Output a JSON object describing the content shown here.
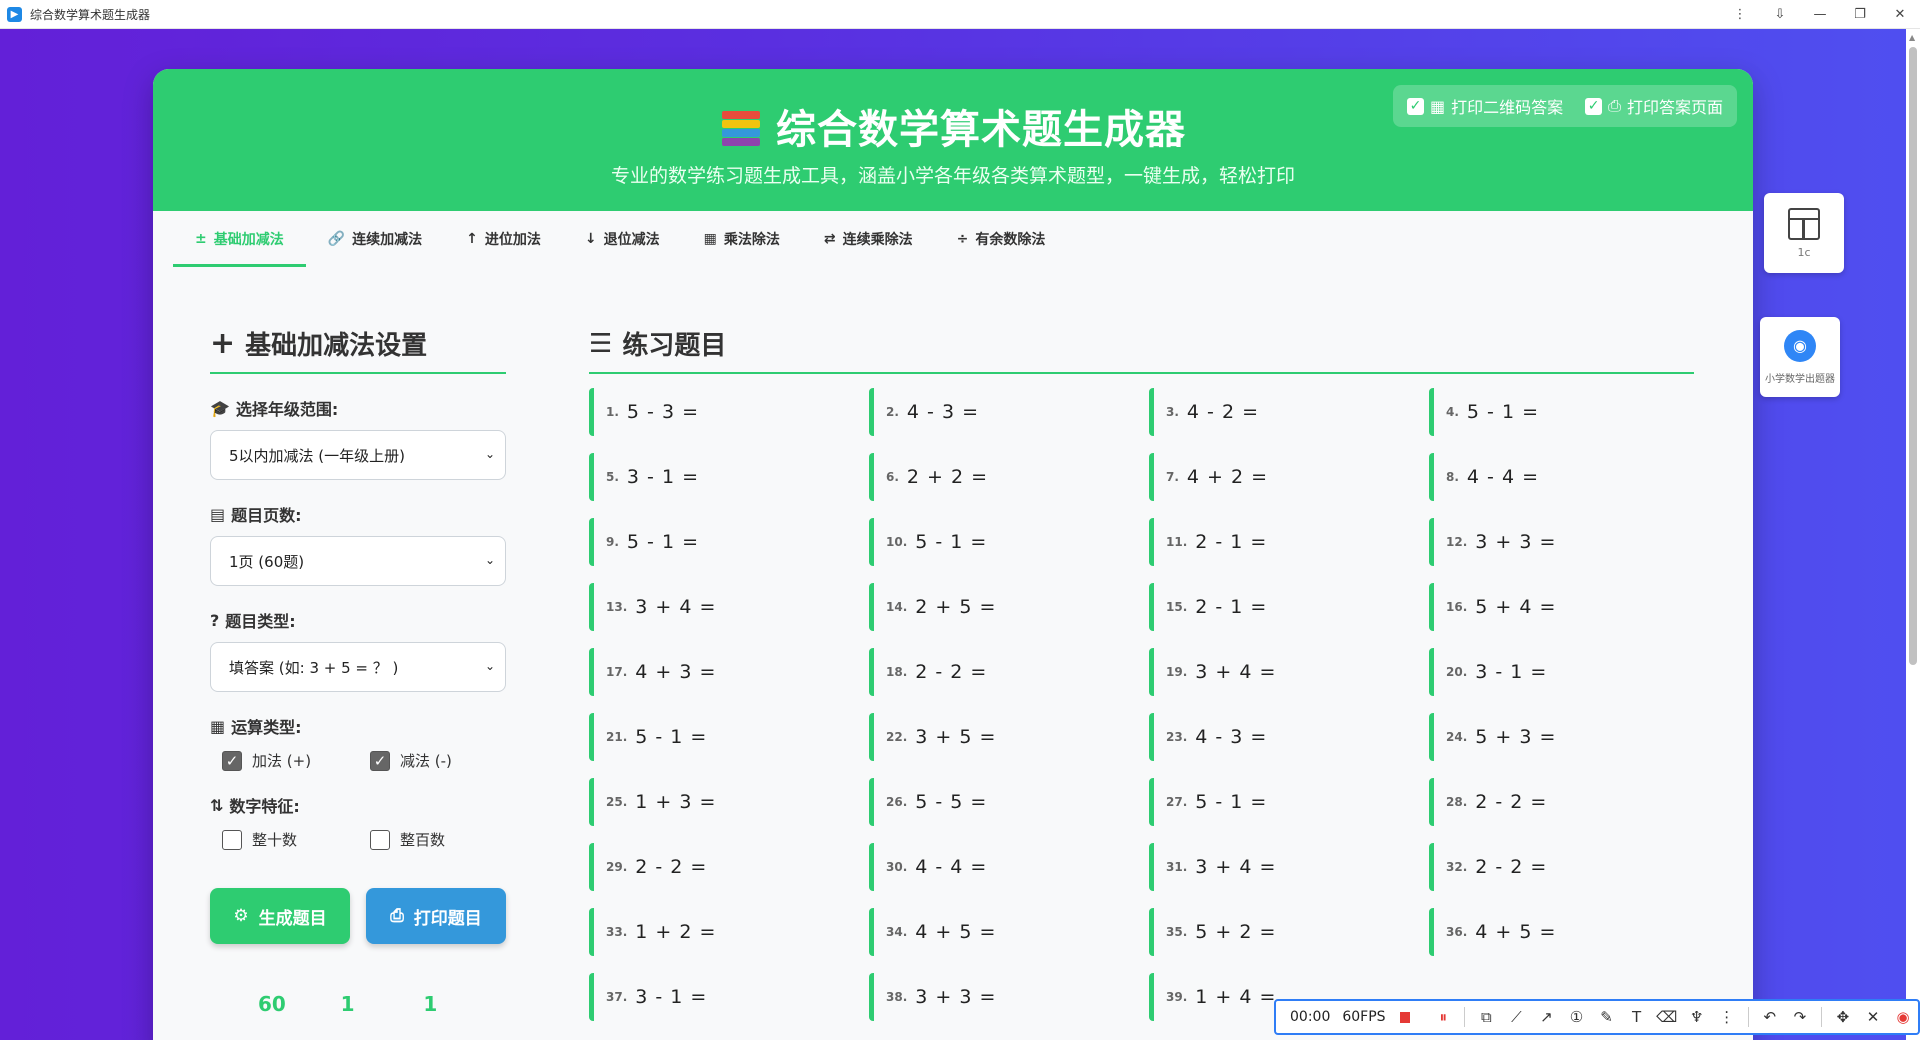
{
  "window": {
    "title": "综合数学算术题生成器",
    "controls": [
      "⋮",
      "⇩",
      "—",
      "❐",
      "✕"
    ]
  },
  "header": {
    "title": "综合数学算术题生成器",
    "subtitle": "专业的数学练习题生成工具，涵盖小学各年级各类算术题型，一键生成，轻松打印",
    "print_options": [
      {
        "label": "打印二维码答案",
        "checked": true,
        "icon": "qrcode-icon"
      },
      {
        "label": "打印答案页面",
        "checked": true,
        "icon": "printer-icon"
      }
    ]
  },
  "tabs": [
    {
      "label": "基础加减法",
      "icon": "±",
      "active": true
    },
    {
      "label": "连续加减法",
      "icon": "🔗",
      "active": false
    },
    {
      "label": "进位加法",
      "icon": "↑",
      "active": false
    },
    {
      "label": "退位减法",
      "icon": "↓",
      "active": false
    },
    {
      "label": "乘法除法",
      "icon": "▦",
      "active": false
    },
    {
      "label": "连续乘除法",
      "icon": "⇄",
      "active": false
    },
    {
      "label": "有余数除法",
      "icon": "÷",
      "active": false
    }
  ],
  "settings": {
    "title": "基础加减法设置",
    "grade_label": "选择年级范围:",
    "grade_value": "5以内加减法 (一年级上册)",
    "pages_label": "题目页数:",
    "pages_value": "1页 (60题)",
    "type_label": "题目类型:",
    "type_value": "填答案 (如: 3 + 5 = ？ )",
    "op_label": "运算类型:",
    "ops": [
      {
        "label": "加法 (+)",
        "checked": true
      },
      {
        "label": "减法 (-)",
        "checked": true
      }
    ],
    "feature_label": "数字特征:",
    "features": [
      {
        "label": "整十数",
        "checked": false
      },
      {
        "label": "整百数",
        "checked": false
      }
    ],
    "generate_label": "生成题目",
    "print_label": "打印题目",
    "stats": [
      "60",
      "1",
      "1"
    ]
  },
  "exercises": {
    "title": "练习题目",
    "items": [
      {
        "num": "1.",
        "expr": "5 - 3 ="
      },
      {
        "num": "2.",
        "expr": "4 - 3 ="
      },
      {
        "num": "3.",
        "expr": "4 - 2 ="
      },
      {
        "num": "4.",
        "expr": "5 - 1 ="
      },
      {
        "num": "5.",
        "expr": "3 - 1 ="
      },
      {
        "num": "6.",
        "expr": "2 + 2 ="
      },
      {
        "num": "7.",
        "expr": "4 + 2 ="
      },
      {
        "num": "8.",
        "expr": "4 - 4 ="
      },
      {
        "num": "9.",
        "expr": "5 - 1 ="
      },
      {
        "num": "10.",
        "expr": "5 - 1 ="
      },
      {
        "num": "11.",
        "expr": "2 - 1 ="
      },
      {
        "num": "12.",
        "expr": "3 + 3 ="
      },
      {
        "num": "13.",
        "expr": "3 + 4 ="
      },
      {
        "num": "14.",
        "expr": "2 + 5 ="
      },
      {
        "num": "15.",
        "expr": "2 - 1 ="
      },
      {
        "num": "16.",
        "expr": "5 + 4 ="
      },
      {
        "num": "17.",
        "expr": "4 + 3 ="
      },
      {
        "num": "18.",
        "expr": "2 - 2 ="
      },
      {
        "num": "19.",
        "expr": "3 + 4 ="
      },
      {
        "num": "20.",
        "expr": "3 - 1 ="
      },
      {
        "num": "21.",
        "expr": "5 - 1 ="
      },
      {
        "num": "22.",
        "expr": "3 + 5 ="
      },
      {
        "num": "23.",
        "expr": "4 - 3 ="
      },
      {
        "num": "24.",
        "expr": "5 + 3 ="
      },
      {
        "num": "25.",
        "expr": "1 + 3 ="
      },
      {
        "num": "26.",
        "expr": "5 - 5 ="
      },
      {
        "num": "27.",
        "expr": "5 - 1 ="
      },
      {
        "num": "28.",
        "expr": "2 - 2 ="
      },
      {
        "num": "29.",
        "expr": "2 - 2 ="
      },
      {
        "num": "30.",
        "expr": "4 - 4 ="
      },
      {
        "num": "31.",
        "expr": "3 + 4 ="
      },
      {
        "num": "32.",
        "expr": "2 - 2 ="
      },
      {
        "num": "33.",
        "expr": "1 + 2 ="
      },
      {
        "num": "34.",
        "expr": "4 + 5 ="
      },
      {
        "num": "35.",
        "expr": "5 + 2 ="
      },
      {
        "num": "36.",
        "expr": "4 + 5 ="
      },
      {
        "num": "37.",
        "expr": "3 - 1 ="
      },
      {
        "num": "38.",
        "expr": "3 + 3 ="
      },
      {
        "num": "39.",
        "expr": "1 + 4 ="
      },
      {
        "num": "",
        "expr": ""
      }
    ]
  },
  "widgets": {
    "layout_widget_caption": "1c",
    "app_widget_caption": "小学数学出题器"
  },
  "recorder": {
    "time": "00:00",
    "fps": "60FPS"
  },
  "colors": {
    "accent": "#2ecc71",
    "print_button": "#3498db",
    "background": "#6320d8"
  }
}
